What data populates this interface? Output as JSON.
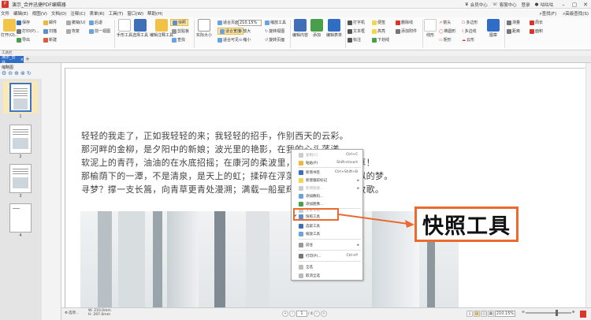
{
  "window": {
    "title": "演示_合并迅捷PDF编辑器",
    "logo_text": "P",
    "vip_label": "会员中心",
    "login_label": "客服中心",
    "user_label": "登录",
    "account_label": "咕咕咕"
  },
  "menu": {
    "items": [
      "文件",
      "编辑(E)",
      "视图(V)",
      "文档(D)",
      "注释(C)",
      "表单(R)",
      "工具(T)",
      "窗口(W)",
      "帮助(H)"
    ],
    "right": [
      "查找(F)",
      "高级查找(S)"
    ]
  },
  "ribbon": {
    "open_label": "打开(O)...",
    "print_label": "打印(P)...",
    "export_label": "导出",
    "email_label": "邮件",
    "scan_label": "扫描",
    "new_label": "新建",
    "save_label": "保存",
    "undo_label": "撤销(U)",
    "redo_label": "恢复",
    "prev_label": "后退",
    "next_view_label": "前一视图",
    "hand_tool_label": "手形工具",
    "select_text_label": "选择工具",
    "edit_content_label": "编辑注释工具",
    "snapshot_label": "快照",
    "clipboard_label": "剪贴板",
    "find_label": "查找",
    "actual_size_label": "实际大小",
    "fit_page_label": "适合页面",
    "fit_width_label": "适合宽度",
    "fit_visible_label": "适合可见",
    "zoom_value": "210.15%",
    "zoom_in_label": "放大",
    "zoom_out_label": "缩小",
    "zoom_tool_label": "缩放工具",
    "rotate_left_label": "旋转视图",
    "rotate_right_label": "旋转页面",
    "edit_form_label": "编辑内容",
    "add_label": "添加",
    "edit_form_field_label": "编辑表单",
    "typewriter_label": "打字机",
    "textbox_label": "文本框",
    "callout_label": "标注",
    "note_label": "便签",
    "highlight_label": "高亮",
    "underline_label": "下划线",
    "strike_label": "删除线",
    "add_note_label": "添加附件",
    "line_label": "线形",
    "arrow_label": "箭头",
    "oval_label": "椭圆形",
    "rect_label": "矩形",
    "polygon_label": "多边形",
    "polyline_label": "多边线",
    "cloud_label": "云形",
    "stamp_label": "图章",
    "measure_label": "测量",
    "distance_label": "距离",
    "perimeter_label": "周长",
    "area_label": "面积",
    "bottom_label": "工具栏"
  },
  "tab": {
    "name": "演示_合并",
    "close": "×",
    "add": "+"
  },
  "leftpanel": {
    "title": "缩略图",
    "pages": [
      "1",
      "2",
      "3",
      "4"
    ]
  },
  "document": {
    "lines": [
      "轻轻的我走了，正如我轻轻的来；我轻轻的招手，作别西天的云彩。",
      "那河畔的金柳，是夕阳中的新娘；波光里的艳影，在我的心头荡漾。",
      "软泥上的青荇，油油的在水底招摇；在康河的柔波里，我甘心做一条水草！",
      "那榆荫下的一潭，不是清泉，是天上的虹；揉碎在浮藻间，沉淀着彩虹似的梦。",
      "寻梦？撑一支长篙，向青草更青处漫溯；满载一船星辉，在星辉斑斓里放歌。"
    ]
  },
  "context_menu": {
    "items": [
      {
        "label": "复制(C)",
        "shortcut": "Ctrl+C",
        "disabled": true
      },
      {
        "label": "粘贴(P)",
        "shortcut": "Shift+Insert",
        "disabled": false
      },
      {
        "label": "新增书签",
        "shortcut": "Ctrl+Shift+B",
        "disabled": false
      },
      {
        "label": "新建跟踪标记",
        "shortcut": "",
        "disabled": false
      },
      {
        "label": "新增链接...",
        "shortcut": "",
        "disabled": true
      },
      {
        "label": "添加数码...",
        "shortcut": "",
        "disabled": false
      },
      {
        "label": "添加图像...",
        "shortcut": "",
        "disabled": false
      },
      {
        "label": "文本工具",
        "shortcut": "",
        "disabled": true
      },
      {
        "label": "快照工具",
        "shortcut": "",
        "disabled": false
      },
      {
        "label": "选取工具",
        "shortcut": "",
        "disabled": false
      },
      {
        "label": "缩放工具",
        "shortcut": "",
        "disabled": false
      },
      {
        "label": "前往",
        "shortcut": "",
        "disabled": false
      },
      {
        "label": "打印(P)...",
        "shortcut": "Ctrl+P",
        "disabled": false
      },
      {
        "label": "全选",
        "shortcut": "",
        "disabled": false
      },
      {
        "label": "取消全选",
        "shortcut": "",
        "disabled": false
      }
    ]
  },
  "callout": {
    "text": "快照工具"
  },
  "statusbar": {
    "options_label": "选项...",
    "width_label": "W: 210.0mm",
    "height_label": "H: 297.0mm",
    "current_page": "1",
    "page_total": "/ 4",
    "zoom_value": "210.15%"
  },
  "colors": {
    "accent": "#2f6ec4",
    "callout": "#ec6a2d",
    "selection": "#f9e9b8"
  }
}
